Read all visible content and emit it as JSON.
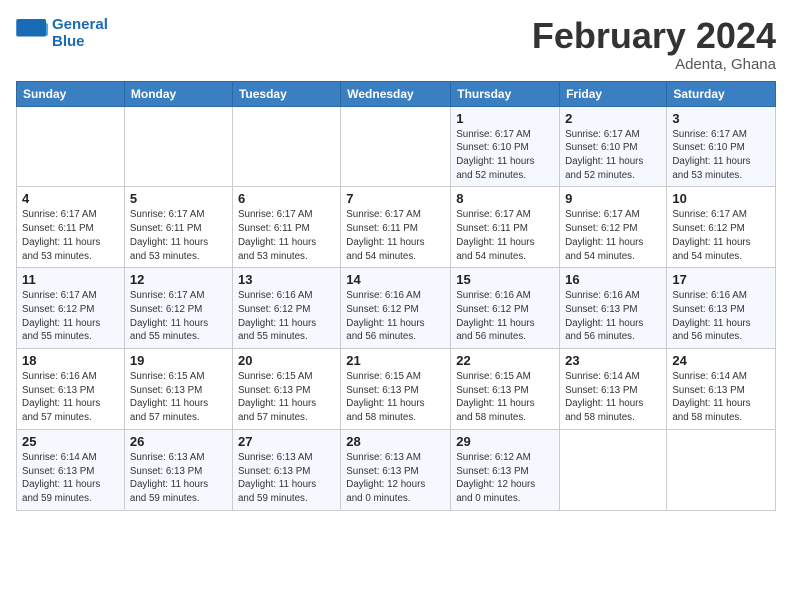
{
  "logo": {
    "line1": "General",
    "line2": "Blue"
  },
  "title": "February 2024",
  "location": "Adenta, Ghana",
  "days_header": [
    "Sunday",
    "Monday",
    "Tuesday",
    "Wednesday",
    "Thursday",
    "Friday",
    "Saturday"
  ],
  "weeks": [
    [
      {
        "day": "",
        "info": ""
      },
      {
        "day": "",
        "info": ""
      },
      {
        "day": "",
        "info": ""
      },
      {
        "day": "",
        "info": ""
      },
      {
        "day": "1",
        "info": "Sunrise: 6:17 AM\nSunset: 6:10 PM\nDaylight: 11 hours\nand 52 minutes."
      },
      {
        "day": "2",
        "info": "Sunrise: 6:17 AM\nSunset: 6:10 PM\nDaylight: 11 hours\nand 52 minutes."
      },
      {
        "day": "3",
        "info": "Sunrise: 6:17 AM\nSunset: 6:10 PM\nDaylight: 11 hours\nand 53 minutes."
      }
    ],
    [
      {
        "day": "4",
        "info": "Sunrise: 6:17 AM\nSunset: 6:11 PM\nDaylight: 11 hours\nand 53 minutes."
      },
      {
        "day": "5",
        "info": "Sunrise: 6:17 AM\nSunset: 6:11 PM\nDaylight: 11 hours\nand 53 minutes."
      },
      {
        "day": "6",
        "info": "Sunrise: 6:17 AM\nSunset: 6:11 PM\nDaylight: 11 hours\nand 53 minutes."
      },
      {
        "day": "7",
        "info": "Sunrise: 6:17 AM\nSunset: 6:11 PM\nDaylight: 11 hours\nand 54 minutes."
      },
      {
        "day": "8",
        "info": "Sunrise: 6:17 AM\nSunset: 6:11 PM\nDaylight: 11 hours\nand 54 minutes."
      },
      {
        "day": "9",
        "info": "Sunrise: 6:17 AM\nSunset: 6:12 PM\nDaylight: 11 hours\nand 54 minutes."
      },
      {
        "day": "10",
        "info": "Sunrise: 6:17 AM\nSunset: 6:12 PM\nDaylight: 11 hours\nand 54 minutes."
      }
    ],
    [
      {
        "day": "11",
        "info": "Sunrise: 6:17 AM\nSunset: 6:12 PM\nDaylight: 11 hours\nand 55 minutes."
      },
      {
        "day": "12",
        "info": "Sunrise: 6:17 AM\nSunset: 6:12 PM\nDaylight: 11 hours\nand 55 minutes."
      },
      {
        "day": "13",
        "info": "Sunrise: 6:16 AM\nSunset: 6:12 PM\nDaylight: 11 hours\nand 55 minutes."
      },
      {
        "day": "14",
        "info": "Sunrise: 6:16 AM\nSunset: 6:12 PM\nDaylight: 11 hours\nand 56 minutes."
      },
      {
        "day": "15",
        "info": "Sunrise: 6:16 AM\nSunset: 6:12 PM\nDaylight: 11 hours\nand 56 minutes."
      },
      {
        "day": "16",
        "info": "Sunrise: 6:16 AM\nSunset: 6:13 PM\nDaylight: 11 hours\nand 56 minutes."
      },
      {
        "day": "17",
        "info": "Sunrise: 6:16 AM\nSunset: 6:13 PM\nDaylight: 11 hours\nand 56 minutes."
      }
    ],
    [
      {
        "day": "18",
        "info": "Sunrise: 6:16 AM\nSunset: 6:13 PM\nDaylight: 11 hours\nand 57 minutes."
      },
      {
        "day": "19",
        "info": "Sunrise: 6:15 AM\nSunset: 6:13 PM\nDaylight: 11 hours\nand 57 minutes."
      },
      {
        "day": "20",
        "info": "Sunrise: 6:15 AM\nSunset: 6:13 PM\nDaylight: 11 hours\nand 57 minutes."
      },
      {
        "day": "21",
        "info": "Sunrise: 6:15 AM\nSunset: 6:13 PM\nDaylight: 11 hours\nand 58 minutes."
      },
      {
        "day": "22",
        "info": "Sunrise: 6:15 AM\nSunset: 6:13 PM\nDaylight: 11 hours\nand 58 minutes."
      },
      {
        "day": "23",
        "info": "Sunrise: 6:14 AM\nSunset: 6:13 PM\nDaylight: 11 hours\nand 58 minutes."
      },
      {
        "day": "24",
        "info": "Sunrise: 6:14 AM\nSunset: 6:13 PM\nDaylight: 11 hours\nand 58 minutes."
      }
    ],
    [
      {
        "day": "25",
        "info": "Sunrise: 6:14 AM\nSunset: 6:13 PM\nDaylight: 11 hours\nand 59 minutes."
      },
      {
        "day": "26",
        "info": "Sunrise: 6:13 AM\nSunset: 6:13 PM\nDaylight: 11 hours\nand 59 minutes."
      },
      {
        "day": "27",
        "info": "Sunrise: 6:13 AM\nSunset: 6:13 PM\nDaylight: 11 hours\nand 59 minutes."
      },
      {
        "day": "28",
        "info": "Sunrise: 6:13 AM\nSunset: 6:13 PM\nDaylight: 12 hours\nand 0 minutes."
      },
      {
        "day": "29",
        "info": "Sunrise: 6:12 AM\nSunset: 6:13 PM\nDaylight: 12 hours\nand 0 minutes."
      },
      {
        "day": "",
        "info": ""
      },
      {
        "day": "",
        "info": ""
      }
    ]
  ]
}
